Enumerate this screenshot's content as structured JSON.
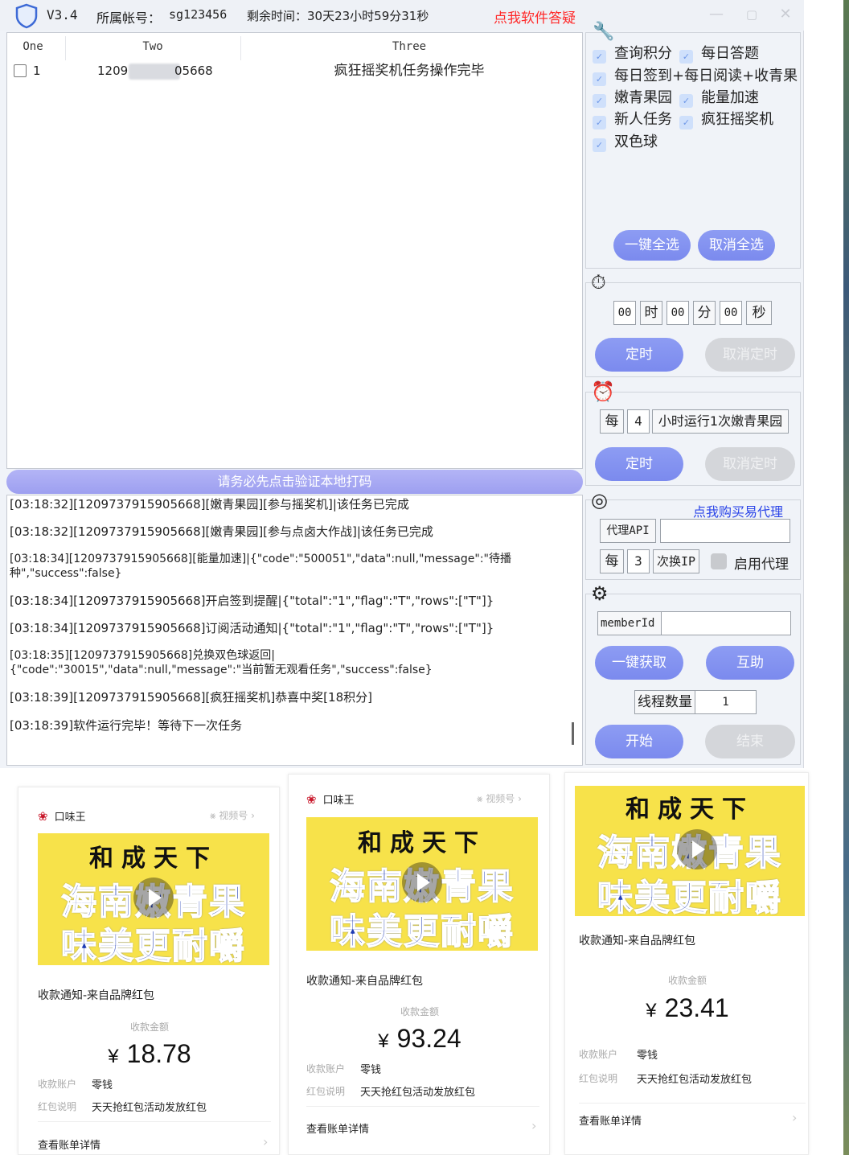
{
  "titlebar": {
    "version": "V3.4",
    "account_label": "所属帐号：",
    "account_value": "sg123456",
    "remaining": "剩余时间：30天23小时59分31秒",
    "help_link": "点我软件答疑"
  },
  "table": {
    "headers": [
      "One",
      "Two",
      "Three"
    ],
    "rows": [
      {
        "one": "1",
        "two_prefix": "1209",
        "two_suffix": "05668",
        "three": "疯狂摇奖机任务操作完毕"
      }
    ]
  },
  "verify_banner": "请务必先点击验证本地打码",
  "log": [
    "[03:18:32][1209737915905668][嫩青果园][参与摇奖机]|该任务已完成",
    "[03:18:32][1209737915905668][嫩青果园][参与点卤大作战]|该任务已完成",
    "[03:18:34][1209737915905668][能量加速]|{\"code\":\"500051\",\"data\":null,\"message\":\"待播种\",\"success\":false}",
    "[03:18:34][1209737915905668]开启签到提醒|{\"total\":\"1\",\"flag\":\"T\",\"rows\":[\"T\"]}",
    "[03:18:34][1209737915905668]订阅活动通知|{\"total\":\"1\",\"flag\":\"T\",\"rows\":[\"T\"]}",
    "[03:18:35][1209737915905668]兑换双色球返回|\n{\"code\":\"30015\",\"data\":null,\"message\":\"当前暂无观看任务\",\"success\":false}",
    "[03:18:39][1209737915905668][疯狂摇奖机]恭喜中奖[18积分]",
    "[03:18:39]软件运行完毕！等待下一次任务"
  ],
  "tasks": {
    "items": [
      "查询积分",
      "每日答题",
      "每日签到+每日阅读+收青果",
      "嫩青果园",
      "能量加速",
      "新人任务",
      "疯狂摇奖机",
      "双色球"
    ],
    "select_all": "一键全选",
    "deselect_all": "取消全选"
  },
  "timer": {
    "hour_value": "00",
    "hour_unit": "时",
    "minute_value": "00",
    "minute_unit": "分",
    "second_value": "00",
    "second_unit": "秒",
    "set_button": "定时",
    "cancel_button": "取消定时"
  },
  "interval": {
    "every": "每",
    "hours": "4",
    "desc": "小时运行1次嫩青果园",
    "set_button": "定时",
    "cancel_button": "取消定时"
  },
  "proxy": {
    "buy_link": "点我购买易代理",
    "api_label": "代理API",
    "api_value": "",
    "every": "每",
    "count": "3",
    "change_ip": "次换IP",
    "enable_label": "启用代理"
  },
  "settings": {
    "member_label": "memberId",
    "member_value": "",
    "fetch_button": "一键获取",
    "assist_button": "互助",
    "threads_label": "线程数量",
    "threads_value": "1",
    "start_button": "开始",
    "stop_button": "结束"
  },
  "receipts": [
    {
      "brand": "口味王",
      "channel": "视频号",
      "poster": [
        "和成天下",
        "海南嫩青果",
        "味美更耐嚼"
      ],
      "title": "收款通知-来自品牌红包",
      "amount_label": "收款金额",
      "currency": "¥",
      "amount": "18.78",
      "account_key": "收款账户",
      "account_val": "零钱",
      "note_key": "红包说明",
      "note_val": "天天抢红包活动发放红包",
      "detail": "查看账单详情"
    },
    {
      "brand": "口味王",
      "channel": "视频号",
      "poster": [
        "和成天下",
        "海南嫩青果",
        "味美更耐嚼"
      ],
      "title": "收款通知-来自品牌红包",
      "amount_label": "收款金额",
      "currency": "¥",
      "amount": "93.24",
      "account_key": "收款账户",
      "account_val": "零钱",
      "note_key": "红包说明",
      "note_val": "天天抢红包活动发放红包",
      "detail": "查看账单详情"
    },
    {
      "brand": "",
      "channel": "",
      "poster": [
        "和成天下",
        "海南嫩青果",
        "味美更耐嚼"
      ],
      "title": "收款通知-来自品牌红包",
      "amount_label": "收款金额",
      "currency": "¥",
      "amount": "23.41",
      "account_key": "收款账户",
      "account_val": "零钱",
      "note_key": "红包说明",
      "note_val": "天天抢红包活动发放红包",
      "detail": "查看账单详情"
    }
  ]
}
